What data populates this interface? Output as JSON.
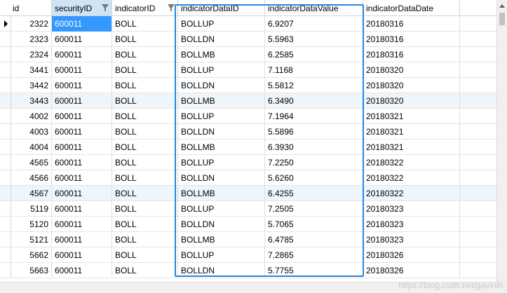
{
  "columns": [
    "id",
    "securityID",
    "indicatorID",
    "indicatorDataID",
    "indicatorDataValue",
    "indicatorDataDate"
  ],
  "rows": [
    [
      "2322",
      "600011",
      "BOLL",
      "BOLLUP",
      "6.9207",
      "20180316"
    ],
    [
      "2323",
      "600011",
      "BOLL",
      "BOLLDN",
      "5.5963",
      "20180316"
    ],
    [
      "2324",
      "600011",
      "BOLL",
      "BOLLMB",
      "6.2585",
      "20180316"
    ],
    [
      "3441",
      "600011",
      "BOLL",
      "BOLLUP",
      "7.1168",
      "20180320"
    ],
    [
      "3442",
      "600011",
      "BOLL",
      "BOLLDN",
      "5.5812",
      "20180320"
    ],
    [
      "3443",
      "600011",
      "BOLL",
      "BOLLMB",
      "6.3490",
      "20180320"
    ],
    [
      "4002",
      "600011",
      "BOLL",
      "BOLLUP",
      "7.1964",
      "20180321"
    ],
    [
      "4003",
      "600011",
      "BOLL",
      "BOLLDN",
      "5.5896",
      "20180321"
    ],
    [
      "4004",
      "600011",
      "BOLL",
      "BOLLMB",
      "6.3930",
      "20180321"
    ],
    [
      "4565",
      "600011",
      "BOLL",
      "BOLLUP",
      "7.2250",
      "20180322"
    ],
    [
      "4566",
      "600011",
      "BOLL",
      "BOLLDN",
      "5.6260",
      "20180322"
    ],
    [
      "4567",
      "600011",
      "BOLL",
      "BOLLMB",
      "6.4255",
      "20180322"
    ],
    [
      "5119",
      "600011",
      "BOLL",
      "BOLLUP",
      "7.2505",
      "20180323"
    ],
    [
      "5120",
      "600011",
      "BOLL",
      "BOLLDN",
      "5.7065",
      "20180323"
    ],
    [
      "5121",
      "600011",
      "BOLL",
      "BOLLMB",
      "6.4785",
      "20180323"
    ],
    [
      "5662",
      "600011",
      "BOLL",
      "BOLLUP",
      "7.2865",
      "20180326"
    ],
    [
      "5663",
      "600011",
      "BOLL",
      "BOLLDN",
      "5.7755",
      "20180326"
    ]
  ],
  "watermark": "https://blog.csdn.net/gavinin",
  "colors": {
    "selection": "#3399ff",
    "highlight_box": "#1e88e5",
    "sorted_header": "#cfe3f7",
    "alt_row": "#eef5fb"
  }
}
